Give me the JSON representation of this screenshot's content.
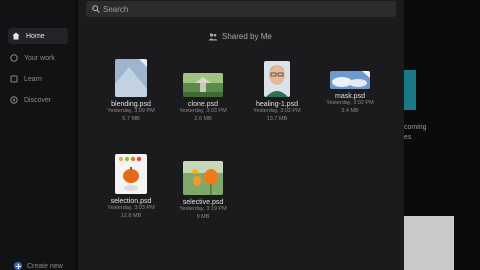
{
  "sidebar": {
    "items": [
      {
        "label": "Home",
        "icon": "home-icon",
        "active": true
      },
      {
        "label": "Your work",
        "icon": "cloud-icon",
        "active": false
      },
      {
        "label": "Learn",
        "icon": "learn-icon",
        "active": false
      },
      {
        "label": "Discover",
        "icon": "discover-icon",
        "active": false
      }
    ],
    "create_label": "Create new"
  },
  "search": {
    "placeholder": "Search"
  },
  "section": {
    "title": "Shared by Me"
  },
  "files": [
    {
      "name": "blending.psd",
      "date": "Yesterday, 3:09 PM",
      "size": "5.7 MB"
    },
    {
      "name": "clone.psd",
      "date": "Yesterday, 3:03 PM",
      "size": "2.6 MB"
    },
    {
      "name": "healing-1.psd",
      "date": "Yesterday, 3:02 PM",
      "size": "13.7 MB"
    },
    {
      "name": "mask.psd",
      "date": "Yesterday, 3:02 PM",
      "size": "3.4 MB"
    },
    {
      "name": "selection.psd",
      "date": "Yesterday, 3:03 PM",
      "size": "12.8 MB"
    },
    {
      "name": "selective.psd",
      "date": "Yesterday, 3:19 PM",
      "size": "9 MB"
    }
  ],
  "background": {
    "text_line_1": "coming",
    "text_line_2": "es"
  },
  "colors": {
    "modal": "#1b1b1d",
    "accent": "#2b6fd6"
  }
}
